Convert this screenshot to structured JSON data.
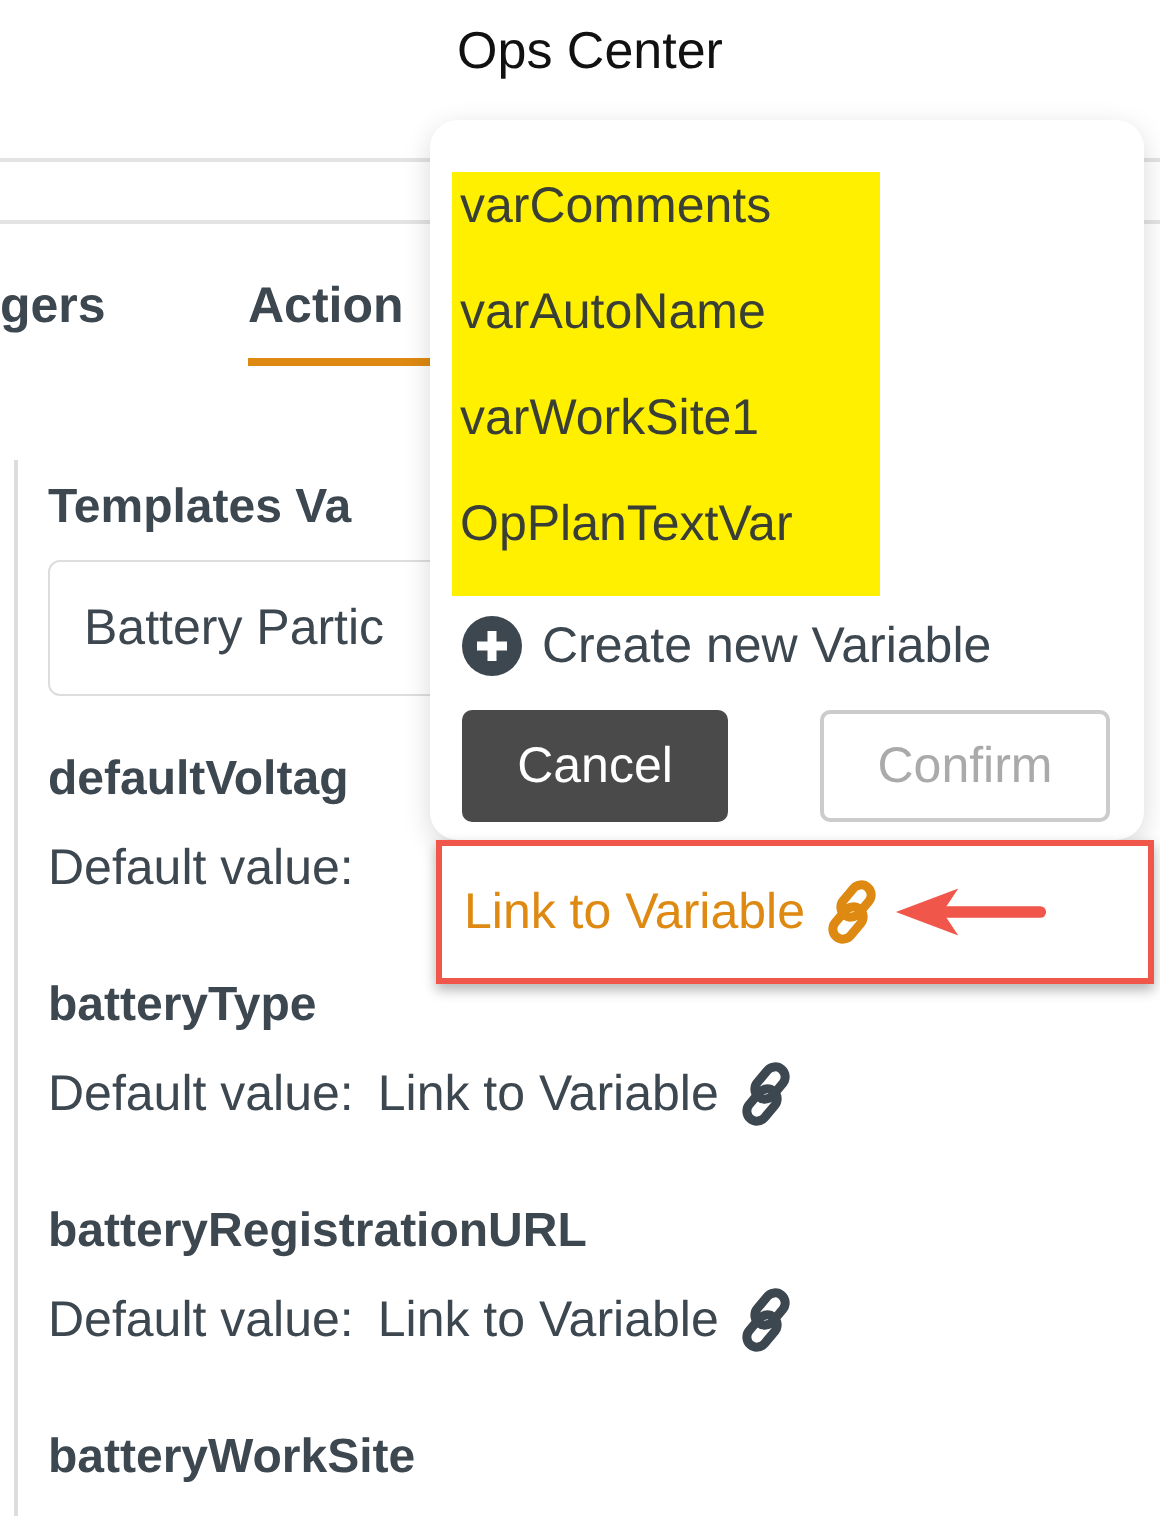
{
  "window": {
    "title": "Ops Center"
  },
  "tabs": [
    {
      "label": "gers",
      "selected": false
    },
    {
      "label": "Action",
      "selected": true
    }
  ],
  "section": {
    "title": "Templates Va",
    "select": {
      "value": "Battery Partic"
    }
  },
  "fields": [
    {
      "name": "defaultVoltag",
      "label": "Default value:"
    },
    {
      "name": "batteryType",
      "label": "Default value:",
      "link": "Link to Variable"
    },
    {
      "name": "batteryRegistrationURL",
      "label": "Default value:",
      "link": "Link to Variable"
    },
    {
      "name": "batteryWorkSite"
    }
  ],
  "popup": {
    "variables": [
      {
        "name": "varComments",
        "highlighted": true
      },
      {
        "name": "varAutoName",
        "highlighted": true
      },
      {
        "name": "varWorkSite1",
        "highlighted": true
      },
      {
        "name": "OpPlanTextVar",
        "highlighted": true
      }
    ],
    "create": "Create new Variable",
    "buttons": [
      {
        "label": "Cancel",
        "kind": "primary"
      },
      {
        "label": "Confirm",
        "kind": "disabled"
      }
    ],
    "link": {
      "label": "Link to Variable",
      "annotated": true
    }
  }
}
